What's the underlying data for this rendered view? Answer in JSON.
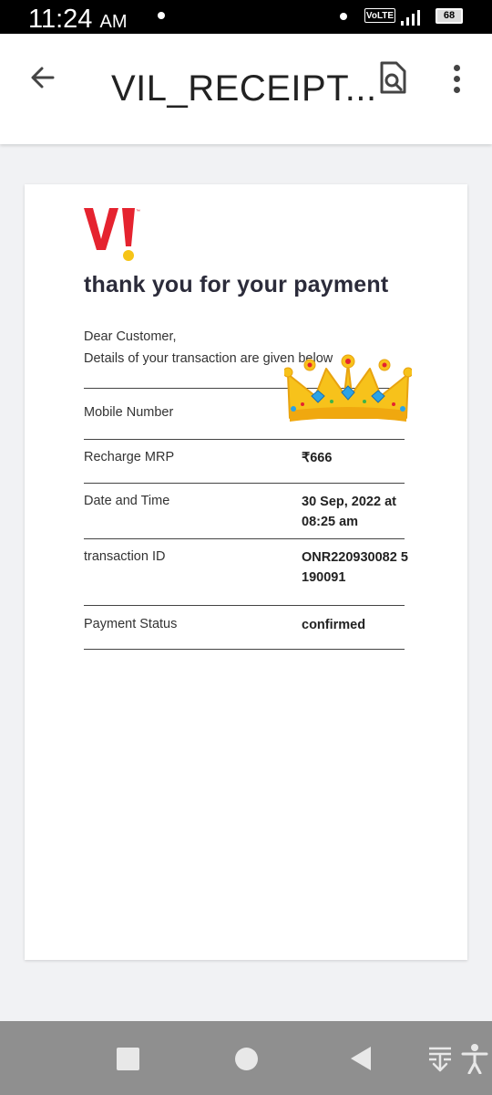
{
  "status_bar": {
    "time": "11:24",
    "ampm": "AM",
    "network_badge": "VoLTE",
    "battery": "68"
  },
  "app_bar": {
    "title": "VIL_RECEIPT..."
  },
  "receipt": {
    "logo_text": "Vi",
    "heading": "thank you for your payment",
    "greeting": "Dear Customer,",
    "intro": "Details of your transaction are given below",
    "rows": [
      {
        "label": "Mobile Number",
        "value": ""
      },
      {
        "label": "Recharge MRP",
        "value": "₹666"
      },
      {
        "label": "Date and Time",
        "value": "30 Sep, 2022 at 08:25 am"
      },
      {
        "label": "transaction ID",
        "value": "ONR220930082 5190091"
      },
      {
        "label": "Payment Status",
        "value": "confirmed"
      }
    ]
  },
  "colors": {
    "brand_red": "#e5232f",
    "brand_yellow": "#f6c417"
  },
  "icons": [
    "arrow-back-icon",
    "document-search-icon",
    "more-vert-icon",
    "crown-sticker",
    "nav-recents-icon",
    "nav-home-icon",
    "nav-back-icon",
    "download-list-icon",
    "accessibility-icon"
  ]
}
